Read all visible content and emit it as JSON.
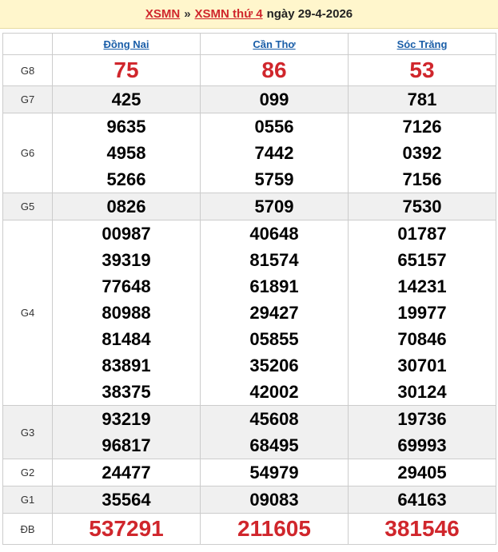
{
  "header": {
    "link1": "XSMN",
    "separator": "»",
    "link2": "XSMN thứ 4",
    "date": "ngày 29-4-2026"
  },
  "provinces": [
    "Đồng Nai",
    "Cần Thơ",
    "Sóc Trăng"
  ],
  "rows": [
    {
      "label": "G8",
      "values": [
        [
          "75"
        ],
        [
          "86"
        ],
        [
          "53"
        ]
      ]
    },
    {
      "label": "G7",
      "values": [
        [
          "425"
        ],
        [
          "099"
        ],
        [
          "781"
        ]
      ]
    },
    {
      "label": "G6",
      "values": [
        [
          "9635",
          "4958",
          "5266"
        ],
        [
          "0556",
          "7442",
          "5759"
        ],
        [
          "7126",
          "0392",
          "7156"
        ]
      ]
    },
    {
      "label": "G5",
      "values": [
        [
          "0826"
        ],
        [
          "5709"
        ],
        [
          "7530"
        ]
      ]
    },
    {
      "label": "G4",
      "values": [
        [
          "00987",
          "39319",
          "77648",
          "80988",
          "81484",
          "83891",
          "38375"
        ],
        [
          "40648",
          "81574",
          "61891",
          "29427",
          "05855",
          "35206",
          "42002"
        ],
        [
          "01787",
          "65157",
          "14231",
          "19977",
          "70846",
          "30701",
          "30124"
        ]
      ]
    },
    {
      "label": "G3",
      "values": [
        [
          "93219",
          "96817"
        ],
        [
          "45608",
          "68495"
        ],
        [
          "19736",
          "69993"
        ]
      ]
    },
    {
      "label": "G2",
      "values": [
        [
          "24477"
        ],
        [
          "54979"
        ],
        [
          "29405"
        ]
      ]
    },
    {
      "label": "G1",
      "values": [
        [
          "35564"
        ],
        [
          "09083"
        ],
        [
          "64163"
        ]
      ]
    },
    {
      "label": "ĐB",
      "values": [
        [
          "537291"
        ],
        [
          "211605"
        ],
        [
          "381546"
        ]
      ]
    }
  ],
  "colors": {
    "accent_red": "#d0262c",
    "link_blue": "#1a5ea8",
    "header_bg": "#fff6cc"
  }
}
